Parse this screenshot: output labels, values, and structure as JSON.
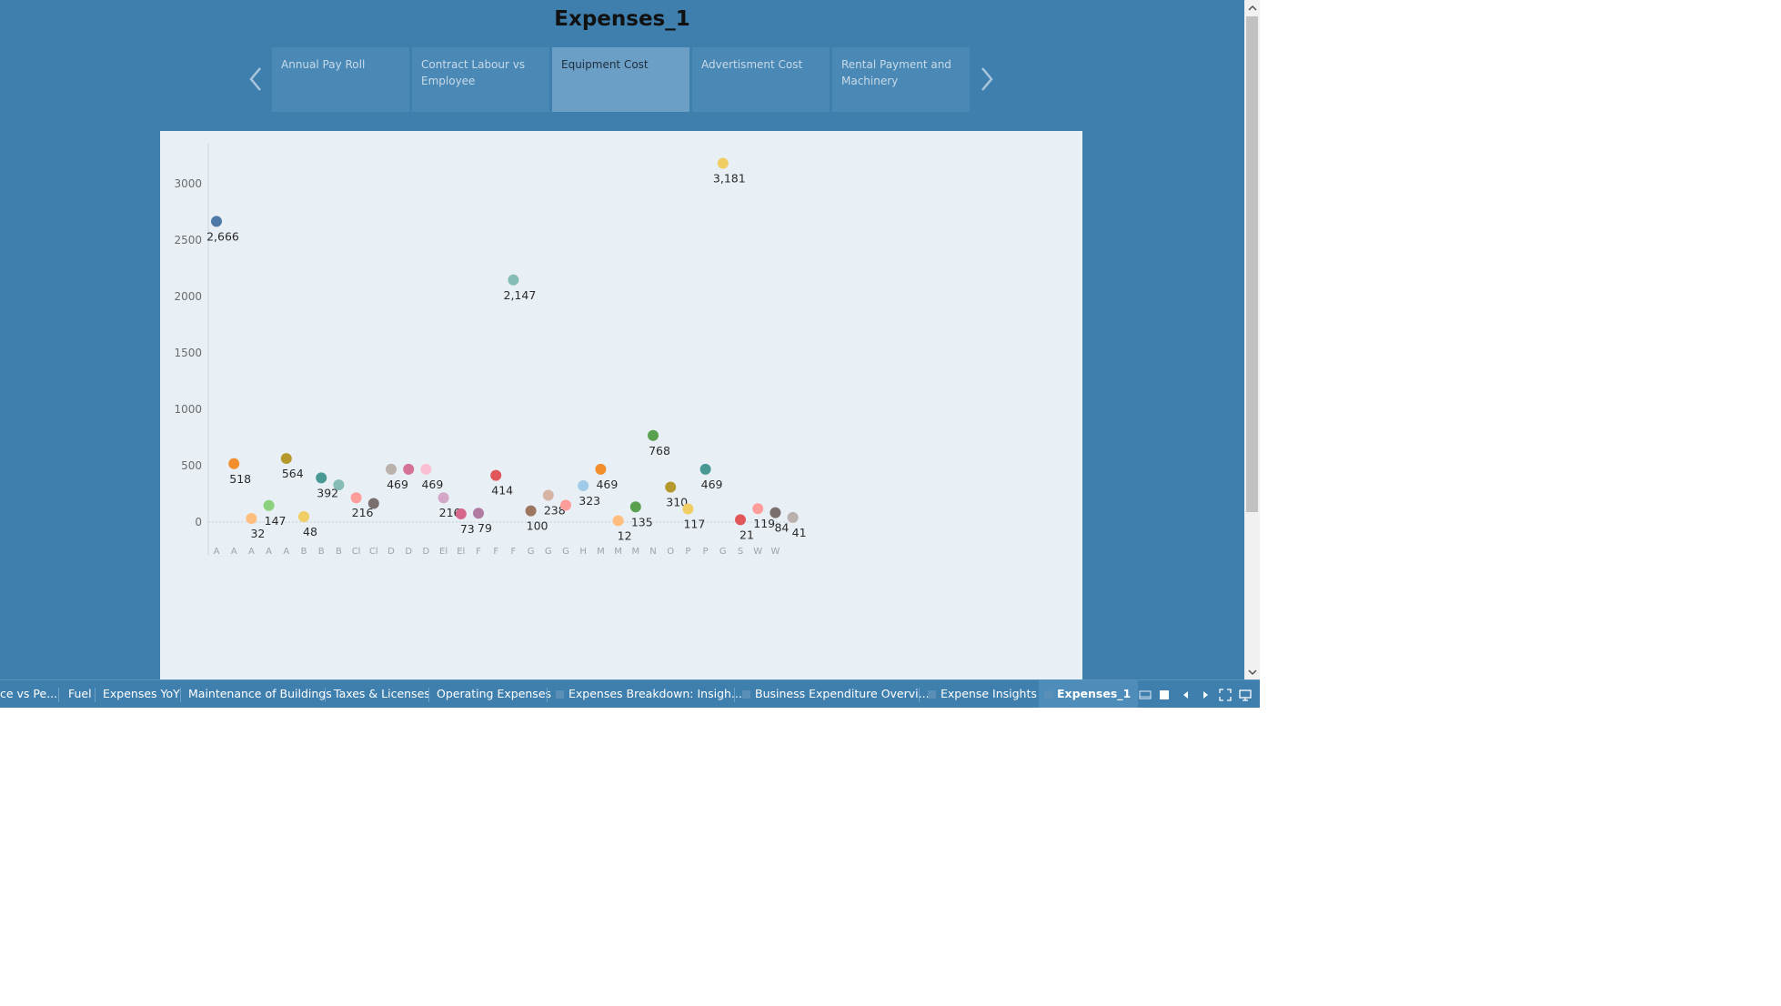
{
  "page_title": "Expenses_1",
  "story_tabs": [
    {
      "label": "Annual Pay Roll",
      "active": false
    },
    {
      "label": "Contract Labour vs Employee",
      "active": false
    },
    {
      "label": "Equipment Cost",
      "active": true
    },
    {
      "label": "Advertisment Cost",
      "active": false
    },
    {
      "label": "Rental Payment and Machinery",
      "active": false
    }
  ],
  "sheet_tabs": [
    {
      "label": "ce vs Pe...",
      "active": false
    },
    {
      "label": "Fuel",
      "active": false
    },
    {
      "label": "Expenses YoY",
      "active": false
    },
    {
      "label": "Maintenance of Buildings",
      "active": false
    },
    {
      "label": "Taxes & Licenses",
      "active": false
    },
    {
      "label": "Operating Expenses",
      "active": false
    },
    {
      "label": "Expenses Breakdown: Insigh...",
      "active": false
    },
    {
      "label": "Business Expenditure Overvi...",
      "active": false
    },
    {
      "label": "Expense Insights",
      "active": false
    },
    {
      "label": "Expenses_1",
      "active": true
    }
  ],
  "icons": {
    "prev_story": "chevron-left-icon",
    "next_story": "chevron-right-icon",
    "scroll_up": "arrow-up-icon",
    "scroll_down": "arrow-down-icon"
  },
  "colors": {
    "background": "#3f7fae",
    "chart_panel": "#e8eff5",
    "active_story_tab": "#6b9fc6",
    "story_tab": "#4a88b5"
  },
  "chart_data": {
    "type": "scatter",
    "title": "",
    "xlabel": "",
    "ylabel": "",
    "ylim": [
      0,
      3300
    ],
    "yticks": [
      0,
      500,
      1000,
      1500,
      2000,
      2500,
      3000
    ],
    "tick_labels": [
      "A",
      "A",
      "A",
      "A",
      "A",
      "B",
      "B",
      "B",
      "Cl",
      "Cl",
      "D",
      "D",
      "D",
      "El",
      "El",
      "F",
      "F",
      "F",
      "G",
      "G",
      "G",
      "H",
      "M",
      "M",
      "M",
      "N",
      "O",
      "P",
      "P",
      "G",
      "S",
      "W",
      "W"
    ],
    "values": [
      2666,
      518,
      32,
      147,
      564,
      48,
      392,
      330,
      216,
      165,
      469,
      469,
      469,
      216,
      73,
      79,
      414,
      2147,
      100,
      238,
      150,
      323,
      469,
      12,
      135,
      768,
      310,
      117,
      469,
      3181,
      21,
      119,
      84,
      41
    ],
    "data_labels": [
      "2,666",
      "518",
      "32",
      "147",
      "564",
      "48",
      "392",
      "",
      "216",
      "",
      "469",
      "",
      "469",
      "216",
      "73",
      "79",
      "414",
      "2,147",
      "100",
      "238",
      "",
      "323",
      "469",
      "12",
      "135",
      "768",
      "310",
      "117",
      "469",
      "3,181",
      "21",
      "119",
      "84",
      "41"
    ],
    "colors": [
      "#4e79a7",
      "#f28e2b",
      "#ffbe7d",
      "#8cd17d",
      "#b6992d",
      "#f1ce63",
      "#499894",
      "#86bcb6",
      "#ff9d9a",
      "#79706e",
      "#bab0ac",
      "#d37295",
      "#fabfd2",
      "#d4a6c8",
      "#d7668b",
      "#b07aa1",
      "#e15759",
      "#86bcb6",
      "#9d7660",
      "#d7b5a6",
      "#ff9d9a",
      "#a0cbe8",
      "#f28e2b",
      "#ffbe7d",
      "#59a14f",
      "#59a14f",
      "#b6992d",
      "#f1ce63",
      "#499894",
      "#f1ce63",
      "#e15759",
      "#ff9d9a",
      "#79706e",
      "#bab0ac"
    ],
    "grid": false,
    "legend": "none"
  }
}
